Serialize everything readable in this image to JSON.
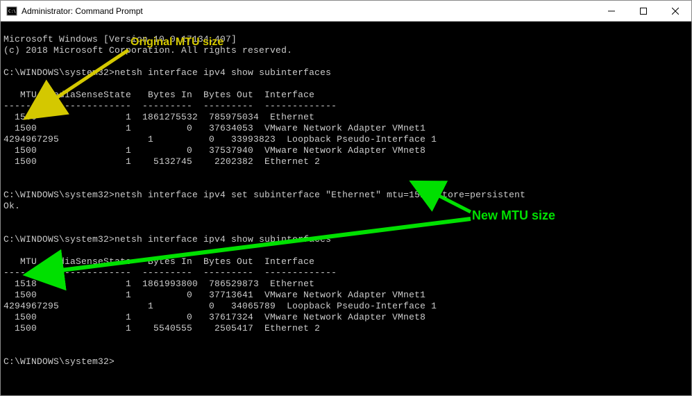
{
  "window": {
    "title": "Administrator: Command Prompt"
  },
  "terminal": {
    "header_line1": "Microsoft Windows [Version 10.0.17134.407]",
    "header_line2": "(c) 2018 Microsoft Corporation. All rights reserved.",
    "prompt1": "C:\\WINDOWS\\system32>",
    "cmd1": "netsh interface ipv4 show subinterfaces",
    "col_header": "   MTU  MediaSenseState   Bytes In  Bytes Out  Interface",
    "col_divider": "------  ---------------  ---------  ---------  -------------",
    "rows1": [
      "  1500                1  1861275532  785975034  Ethernet",
      "  1500                1          0   37634053  VMware Network Adapter VMnet1",
      "4294967295                1          0   33993823  Loopback Pseudo-Interface 1",
      "  1500                1          0   37537940  VMware Network Adapter VMnet8",
      "  1500                1    5132745    2202382  Ethernet 2"
    ],
    "prompt2": "C:\\WINDOWS\\system32>",
    "cmd2": "netsh interface ipv4 set subinterface \"Ethernet\" mtu=1518 store=persistent",
    "ok": "Ok.",
    "prompt3": "C:\\WINDOWS\\system32>",
    "cmd3": "netsh interface ipv4 show subinterfaces",
    "rows2": [
      "  1518                1  1861993800  786529873  Ethernet",
      "  1500                1          0   37713641  VMware Network Adapter VMnet1",
      "4294967295                1          0   34065789  Loopback Pseudo-Interface 1",
      "  1500                1          0   37617324  VMware Network Adapter VMnet8",
      "  1500                1    5540555    2505417  Ethernet 2"
    ],
    "prompt4": "C:\\WINDOWS\\system32>"
  },
  "annotations": {
    "original_label": "Original MTU size",
    "new_label": "New MTU size",
    "yellow_color": "#d4c800",
    "green_color": "#00e000"
  },
  "chart_data": {
    "type": "table",
    "title": "netsh interface ipv4 show subinterfaces",
    "columns": [
      "MTU",
      "MediaSenseState",
      "Bytes In",
      "Bytes Out",
      "Interface"
    ],
    "before": [
      {
        "MTU": 1500,
        "MediaSenseState": 1,
        "BytesIn": 1861275532,
        "BytesOut": 785975034,
        "Interface": "Ethernet"
      },
      {
        "MTU": 1500,
        "MediaSenseState": 1,
        "BytesIn": 0,
        "BytesOut": 37634053,
        "Interface": "VMware Network Adapter VMnet1"
      },
      {
        "MTU": 4294967295,
        "MediaSenseState": 1,
        "BytesIn": 0,
        "BytesOut": 33993823,
        "Interface": "Loopback Pseudo-Interface 1"
      },
      {
        "MTU": 1500,
        "MediaSenseState": 1,
        "BytesIn": 0,
        "BytesOut": 37537940,
        "Interface": "VMware Network Adapter VMnet8"
      },
      {
        "MTU": 1500,
        "MediaSenseState": 1,
        "BytesIn": 5132745,
        "BytesOut": 2202382,
        "Interface": "Ethernet 2"
      }
    ],
    "set_command": "netsh interface ipv4 set subinterface \"Ethernet\" mtu=1518 store=persistent",
    "after": [
      {
        "MTU": 1518,
        "MediaSenseState": 1,
        "BytesIn": 1861993800,
        "BytesOut": 786529873,
        "Interface": "Ethernet"
      },
      {
        "MTU": 1500,
        "MediaSenseState": 1,
        "BytesIn": 0,
        "BytesOut": 37713641,
        "Interface": "VMware Network Adapter VMnet1"
      },
      {
        "MTU": 4294967295,
        "MediaSenseState": 1,
        "BytesIn": 0,
        "BytesOut": 34065789,
        "Interface": "Loopback Pseudo-Interface 1"
      },
      {
        "MTU": 1500,
        "MediaSenseState": 1,
        "BytesIn": 0,
        "BytesOut": 37617324,
        "Interface": "VMware Network Adapter VMnet8"
      },
      {
        "MTU": 1500,
        "MediaSenseState": 1,
        "BytesIn": 5540555,
        "BytesOut": 2505417,
        "Interface": "Ethernet 2"
      }
    ]
  }
}
